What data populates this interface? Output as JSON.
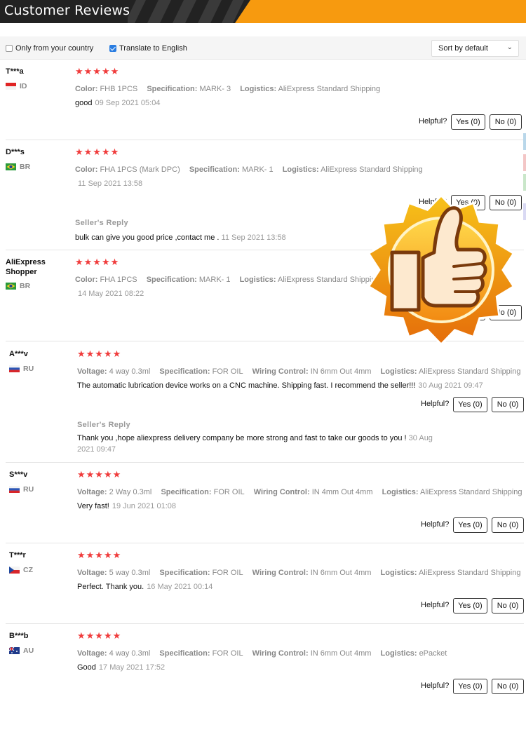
{
  "header": {
    "title": "Customer Reviews"
  },
  "filters": {
    "only_country": {
      "label": "Only from your country",
      "checked": false
    },
    "translate": {
      "label": "Translate to English",
      "checked": true
    },
    "sort": {
      "label": "Sort by default"
    }
  },
  "helpful_label": "Helpful?",
  "reviews": [
    {
      "user": "T***a",
      "country": "ID",
      "stars": "★★★★★",
      "meta": [
        {
          "k": "Color:",
          "v": "FHB 1PCS"
        },
        {
          "k": "Specification:",
          "v": "MARK- 3"
        },
        {
          "k": "Logistics:",
          "v": "AliExpress Standard Shipping"
        }
      ],
      "text": "good",
      "date": "09 Sep 2021 05:04",
      "yes": "Yes (0)",
      "no": "No (0)"
    },
    {
      "user": "D***s",
      "country": "BR",
      "stars": "★★★★★",
      "meta": [
        {
          "k": "Color:",
          "v": "FHA 1PCS (Mark DPC)"
        },
        {
          "k": "Specification:",
          "v": "MARK- 1"
        },
        {
          "k": "Logistics:",
          "v": "AliExpress Standard Shipping"
        }
      ],
      "text": "",
      "date": "11 Sep 2021 13:58",
      "yes": "Yes (0)",
      "no": "No (0)",
      "reply": {
        "title": "Seller's Reply",
        "text": "bulk can give you good price ,contact me .",
        "date": "11 Sep 2021 13:58"
      }
    },
    {
      "user": "AliExpress Shopper",
      "country": "BR",
      "stars": "★★★★★",
      "meta": [
        {
          "k": "Color:",
          "v": "FHA 1PCS"
        },
        {
          "k": "Specification:",
          "v": "MARK- 1"
        },
        {
          "k": "Logistics:",
          "v": "AliExpress Standard Shipping"
        }
      ],
      "text": "",
      "date": "14 May 2021 08:22",
      "yes": "Yes (0)",
      "no": "No (0)"
    },
    {
      "user": "A***v",
      "country": "RU",
      "stars": "★★★★★",
      "meta": [
        {
          "k": "Voltage:",
          "v": "4 way 0.3ml"
        },
        {
          "k": "Specification:",
          "v": "FOR OIL"
        },
        {
          "k": "Wiring Control:",
          "v": "IN 6mm Out 4mm"
        },
        {
          "k": "Logistics:",
          "v": "AliExpress Standard Shipping"
        }
      ],
      "text": "The automatic lubrication device works on a CNC machine. Shipping fast. I recommend the seller!!!",
      "date": "30 Aug 2021 09:47",
      "yes": "Yes (0)",
      "no": "No (0)",
      "reply": {
        "title": "Seller's Reply",
        "text": "Thank you ,hope aliexpress delivery company be more strong and fast to take our goods to you !",
        "date": "30 Aug 2021 09:47"
      }
    },
    {
      "user": "S***v",
      "country": "RU",
      "stars": "★★★★★",
      "meta": [
        {
          "k": "Voltage:",
          "v": "2 Way 0.3ml"
        },
        {
          "k": "Specification:",
          "v": "FOR OIL"
        },
        {
          "k": "Wiring Control:",
          "v": "IN 4mm Out 4mm"
        },
        {
          "k": "Logistics:",
          "v": "AliExpress Standard Shipping"
        }
      ],
      "text": "Very fast!",
      "date": "19 Jun 2021 01:08",
      "yes": "Yes (0)",
      "no": "No (0)"
    },
    {
      "user": "T***r",
      "country": "CZ",
      "stars": "★★★★★",
      "meta": [
        {
          "k": "Voltage:",
          "v": "5 way 0.3ml"
        },
        {
          "k": "Specification:",
          "v": "FOR OIL"
        },
        {
          "k": "Wiring Control:",
          "v": "IN 6mm Out 4mm"
        },
        {
          "k": "Logistics:",
          "v": "AliExpress Standard Shipping"
        }
      ],
      "text": "Perfect. Thank you.",
      "date": "16 May 2021 00:14",
      "yes": "Yes (0)",
      "no": "No (0)"
    },
    {
      "user": "B***b",
      "country": "AU",
      "stars": "★★★★★",
      "meta": [
        {
          "k": "Voltage:",
          "v": "4 way 0.3ml"
        },
        {
          "k": "Specification:",
          "v": "FOR OIL"
        },
        {
          "k": "Wiring Control:",
          "v": "IN 6mm Out 4mm"
        },
        {
          "k": "Logistics:",
          "v": "ePacket"
        }
      ],
      "text": "Good",
      "date": "17 May 2021 17:52",
      "yes": "Yes (0)",
      "no": "No (0)"
    }
  ],
  "colors": {
    "accent_orange": "#f79a0f",
    "star_red": "#f03b3b",
    "checkbox_blue": "#2a7de1"
  },
  "badge_icon": "thumbs-up-badge-icon"
}
